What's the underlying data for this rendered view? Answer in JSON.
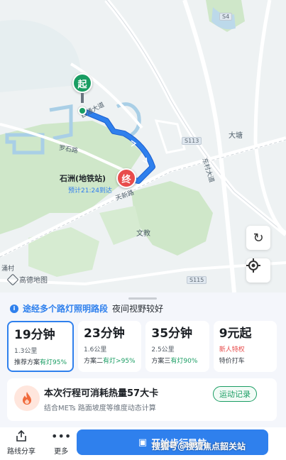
{
  "map": {
    "road_labels": {
      "xitong": "西通大道",
      "luoshi": "罗石路",
      "dongcun": "东村大道",
      "tianxin": "天新路"
    },
    "route_signs": {
      "s4": "S4",
      "s113": "S113",
      "s115": "S115"
    },
    "place_labels": {
      "datang": "大塘",
      "wenjiao": "文教",
      "village": "涌村"
    },
    "end_station": "石洲(地铁站)",
    "eta": "预计21:24到达",
    "start_marker": "起",
    "end_marker": "终",
    "logo_text": "高德地图",
    "buttons": {
      "refresh_icon": "refresh-icon",
      "locate_icon": "locate-icon"
    },
    "colors": {
      "route": "#2f80ed",
      "start": "#1a9d63",
      "end": "#e84c4c"
    }
  },
  "tip": {
    "icon": "i",
    "highlight": "途经多个路灯照明路段",
    "text": "夜间视野较好"
  },
  "plans": [
    {
      "time": "19分钟",
      "distance": "1.3公里",
      "tag_prefix": "推荐方案",
      "tag_light": "有灯95%"
    },
    {
      "time": "23分钟",
      "distance": "1.6公里",
      "tag_prefix": "方案二",
      "tag_light": "有灯>95%"
    },
    {
      "time": "35分钟",
      "distance": "2.5公里",
      "tag_prefix": "方案三",
      "tag_light": "有灯90%"
    },
    {
      "time": "9元起",
      "distance": "新人特权",
      "tag_prefix": "特价打车",
      "tag_light": ""
    }
  ],
  "calorie": {
    "title": "本次行程可消耗热量57大卡",
    "subtitle": "结合METs 路面坡度等维度动态计算",
    "button": "运动记录"
  },
  "bottom": {
    "share": "路线分享",
    "more": "更多",
    "go_button": "开始步行导航"
  },
  "watermark": "搜狐号@搜狐焦点韶关站"
}
